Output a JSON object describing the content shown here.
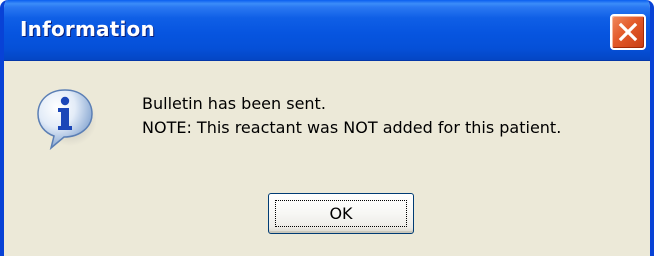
{
  "dialog": {
    "title": "Information",
    "icon": "info-icon",
    "close_icon": "close-icon",
    "message_line1": "Bulletin has been sent.",
    "message_line2": "NOTE: This reactant was NOT added for this patient.",
    "ok_label": "OK"
  },
  "colors": {
    "titlebar": "#0755e0",
    "frame": "#0842d6",
    "body": "#ece9d8",
    "close_button": "#e35a2a"
  }
}
